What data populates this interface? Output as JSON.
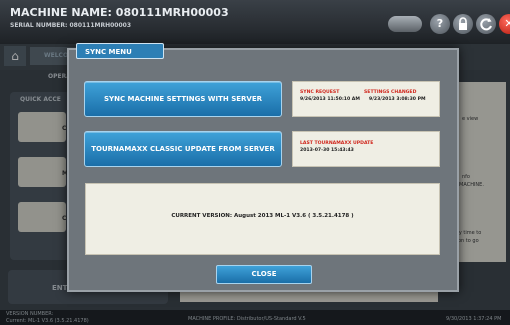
{
  "header": {
    "machine_name": "MACHINE NAME: 080111MRH00003",
    "serial_number": "SERIAL NUMBER: 080111MRH00003",
    "help_icon": "?",
    "close_icon": "✕"
  },
  "nav": {
    "home_icon": "home-icon",
    "tab_label": "WELCOM"
  },
  "background": {
    "section_label": "OPERA",
    "quick_access_label": "QUICK ACCE",
    "quick_items": [
      "CO",
      "MA",
      "CO"
    ],
    "right_notes": [
      "e view",
      "nfo",
      "THIS MACHINE.",
      "at any time to",
      "ne icon to go"
    ],
    "enter_label": "ENTE CONTROL PANEL",
    "server_connection": "LAST SERVER CONNECTION 9/30/2013 1:00:32 PM"
  },
  "statusbar": {
    "version_number_label": "VERSION NUMBER:",
    "version_number_value": "Current: ML-1 V3.6 (3.5.21.4178)",
    "machine_profile": "MACHINE PROFILE: Distributor/US-Standard V.5",
    "datetime": "9/30/2013 1:37:24 PM"
  },
  "sync_menu": {
    "title": "SYNC MENU",
    "sync_settings_button": "SYNC MACHINE SETTINGS WITH SERVER",
    "sync_request_label": "SYNC REQUEST",
    "sync_request_value": "9/26/2013 11:50:10 AM",
    "settings_changed_label": "SETTINGS CHANGED",
    "settings_changed_value": "9/23/2013 3:08:30 PM",
    "classic_update_button": "TOURNAMAXX CLASSIC UPDATE FROM SERVER",
    "last_update_label": "LAST TOURNAMAXX UPDATE",
    "last_update_value": "2013-07-30 15:43:43",
    "current_version": "CURRENT VERSION: August 2013 ML-1 V3.6 ( 3.5.21.4178 )",
    "close_button": "CLOSE"
  },
  "colors": {
    "accent_blue": "#2d7fb5",
    "alert_red": "#d0261c",
    "panel_beige": "#efeee4",
    "close_red": "#b3180c"
  }
}
